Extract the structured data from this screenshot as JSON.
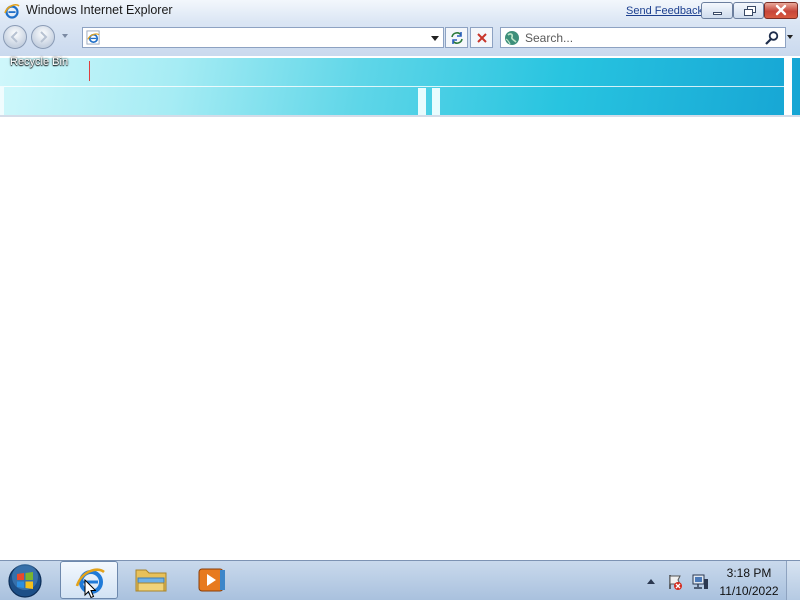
{
  "window": {
    "title": "Windows Internet Explorer",
    "send_feedback": "Send Feedback",
    "minimize_icon": "minimize-icon",
    "maximize_icon": "restore-icon",
    "close_icon": "close-icon"
  },
  "navbar": {
    "address_value": "",
    "search_placeholder": "Search...",
    "search_value": ""
  },
  "content": {
    "stale_label": "Recycle Bin"
  },
  "taskbar": {
    "pinned": [
      "internet-explorer",
      "windows-explorer",
      "windows-media-player"
    ],
    "active": "internet-explorer",
    "clock_time": "3:18 PM",
    "clock_date": "11/10/2022"
  },
  "colors": {
    "accent_gradient_start": "#cff7fb",
    "accent_gradient_end": "#16a5d4",
    "taskbar": "#b9cde6",
    "close_button": "#c7463a"
  }
}
